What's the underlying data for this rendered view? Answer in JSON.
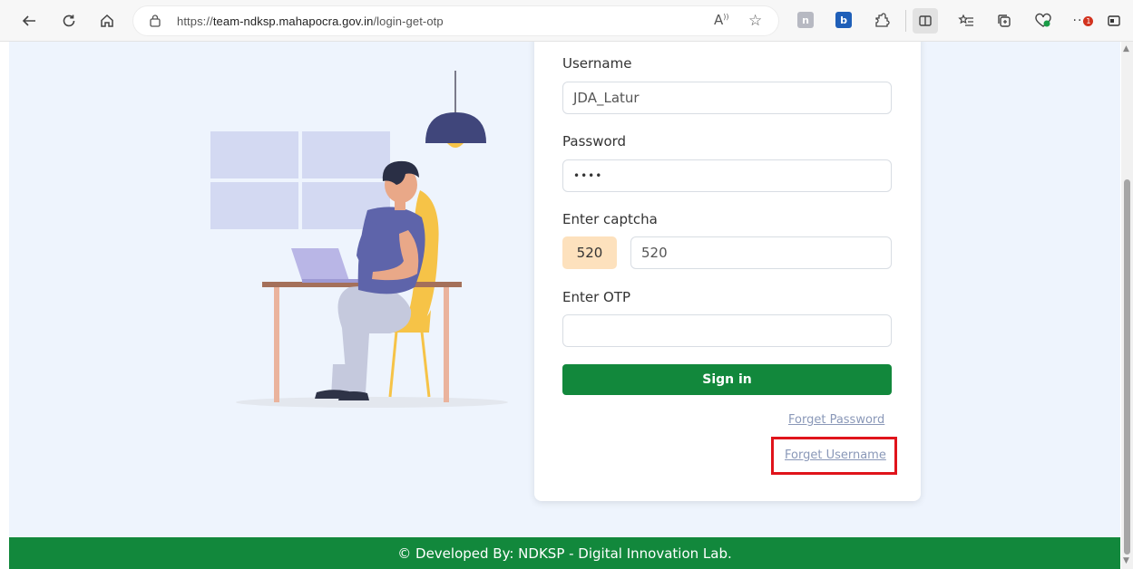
{
  "browser": {
    "url_prefix": "https://",
    "url_domain": "team-ndksp.mahapocra.gov.in",
    "url_path": "/login-get-otp",
    "reader_aloud_label": "A",
    "notification_count": "1"
  },
  "form": {
    "username_label": "Username",
    "username_value": "JDA_Latur",
    "password_label": "Password",
    "password_value": "••••",
    "captcha_label": "Enter captcha",
    "captcha_code": "520",
    "captcha_value": "520",
    "otp_label": "Enter OTP",
    "otp_value": "",
    "signin_label": "Sign in",
    "forget_password_label": "Forget Password",
    "forget_username_label": "Forget Username"
  },
  "footer": {
    "text": "© Developed By: NDKSP - Digital Innovation Lab."
  },
  "colors": {
    "primary_green": "#12883c",
    "highlight_red": "#e0141b",
    "page_bg": "#eef4fd",
    "captcha_bg": "#fde1bd"
  },
  "icons": [
    "back-icon",
    "refresh-icon",
    "home-icon",
    "site-info-icon",
    "read-aloud-icon",
    "favorite-star-icon",
    "extension-icon",
    "puzzle-icon",
    "split-screen-icon",
    "favorites-list-icon",
    "collections-icon",
    "performance-icon",
    "more-icon",
    "sidebar-icon"
  ]
}
